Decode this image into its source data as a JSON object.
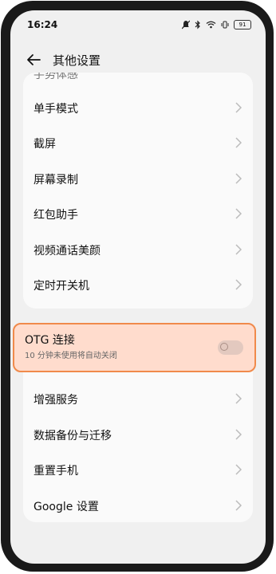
{
  "status_bar": {
    "time": "16:24",
    "battery": "91"
  },
  "header": {
    "title": "其他设置"
  },
  "menu": {
    "partial_label": "手势体感",
    "items": [
      {
        "label": "单手模式"
      },
      {
        "label": "截屏"
      },
      {
        "label": "屏幕录制"
      },
      {
        "label": "红包助手"
      },
      {
        "label": "视频通话美颜"
      },
      {
        "label": "定时开关机"
      }
    ]
  },
  "otg": {
    "label": "OTG 连接",
    "subtitle": "10 分钟未使用将自动关闭",
    "enabled": false
  },
  "menu2": {
    "items": [
      {
        "label": "增强服务"
      },
      {
        "label": "数据备份与迁移"
      },
      {
        "label": "重置手机"
      },
      {
        "label": "Google 设置"
      }
    ]
  },
  "colors": {
    "highlight_border": "#f08a4b",
    "highlight_fill": "#ffdccd"
  }
}
